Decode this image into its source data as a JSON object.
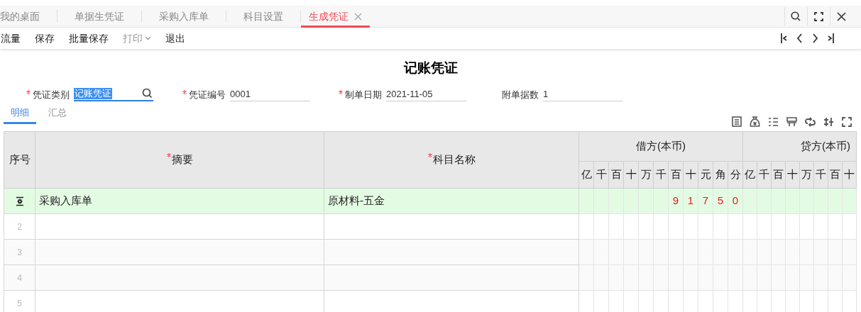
{
  "tabs": [
    {
      "label": "我的桌面",
      "selected": false,
      "closable": false
    },
    {
      "label": "单据生凭证",
      "selected": false,
      "closable": false
    },
    {
      "label": "采购入库单",
      "selected": false,
      "closable": false
    },
    {
      "label": "科目设置",
      "selected": false,
      "closable": false
    },
    {
      "label": "生成凭证",
      "selected": true,
      "closable": true
    }
  ],
  "toolbar": [
    {
      "label": "流量",
      "disabled": false,
      "dropdown": false
    },
    {
      "label": "保存",
      "disabled": false,
      "dropdown": false
    },
    {
      "label": "批量保存",
      "disabled": false,
      "dropdown": false
    },
    {
      "label": "打印",
      "disabled": true,
      "dropdown": true
    },
    {
      "label": "退出",
      "disabled": false,
      "dropdown": false
    }
  ],
  "title": "记账凭证",
  "fields": [
    {
      "label": "凭证类别",
      "value": "记账凭证",
      "required": true,
      "focused": true,
      "lookup": true
    },
    {
      "label": "凭证编号",
      "value": "0001",
      "required": true,
      "focused": false,
      "lookup": false
    },
    {
      "label": "制单日期",
      "value": "2021-11-05",
      "required": true,
      "focused": false,
      "lookup": false
    },
    {
      "label": "附单据数",
      "value": "1",
      "required": false,
      "focused": false,
      "lookup": false
    }
  ],
  "sub_tabs": [
    {
      "label": "明细",
      "selected": true
    },
    {
      "label": "汇总",
      "selected": false
    }
  ],
  "table": {
    "columns": [
      {
        "label": "序号",
        "required": false
      },
      {
        "label": "摘要",
        "required": true
      },
      {
        "label": "科目名称",
        "required": true
      }
    ],
    "debit_header": "借方(本币)",
    "debit_units": [
      "亿",
      "千",
      "百",
      "十",
      "万",
      "千",
      "百",
      "十",
      "元",
      "角",
      "分"
    ],
    "credit_header": "贷方(本币)",
    "credit_units": [
      "亿",
      "千",
      "百",
      "十",
      "万",
      "千",
      "百",
      "十"
    ],
    "rows": [
      {
        "seq": null,
        "summary": "采购入库单",
        "account": "原材料-五金",
        "debit_digits": [
          "9",
          "1",
          "7",
          "5",
          "0"
        ],
        "selected": true
      },
      {
        "seq": "2",
        "summary": null,
        "account": null,
        "debit_digits": [],
        "selected": false
      },
      {
        "seq": "3",
        "summary": null,
        "account": null,
        "debit_digits": [],
        "selected": false
      },
      {
        "seq": "4",
        "summary": null,
        "account": null,
        "debit_digits": [],
        "selected": false
      },
      {
        "seq": "5",
        "summary": null,
        "account": null,
        "debit_digits": [],
        "selected": false
      }
    ]
  }
}
